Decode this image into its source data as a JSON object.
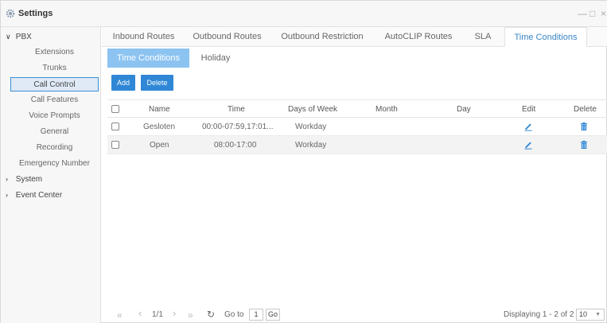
{
  "window": {
    "title": "Settings",
    "controls": {
      "minimize": "—",
      "maximize": "□",
      "close": "×"
    }
  },
  "sidebar": {
    "pbx_label": "PBX",
    "items": [
      {
        "label": "Extensions"
      },
      {
        "label": "Trunks"
      },
      {
        "label": "Call Control",
        "active": true
      },
      {
        "label": "Call Features"
      },
      {
        "label": "Voice Prompts"
      },
      {
        "label": "General"
      },
      {
        "label": "Recording"
      },
      {
        "label": "Emergency Number"
      }
    ],
    "system_label": "System",
    "event_center_label": "Event Center"
  },
  "tabs": [
    {
      "label": "Inbound Routes"
    },
    {
      "label": "Outbound Routes"
    },
    {
      "label": "Outbound Restriction"
    },
    {
      "label": "AutoCLIP Routes"
    },
    {
      "label": "SLA"
    },
    {
      "label": "Time Conditions",
      "active": true
    }
  ],
  "subtabs": [
    {
      "label": "Time Conditions",
      "active": true
    },
    {
      "label": "Holiday"
    }
  ],
  "toolbar": {
    "add_label": "Add",
    "delete_label": "Delete"
  },
  "table": {
    "headers": {
      "name": "Name",
      "time": "Time",
      "days": "Days of Week",
      "month": "Month",
      "day": "Day",
      "edit": "Edit",
      "delete": "Delete"
    },
    "rows": [
      {
        "name": "Gesloten",
        "time": "00:00-07:59,17:01...",
        "days": "Workday",
        "month": "",
        "day": ""
      },
      {
        "name": "Open",
        "time": "08:00-17:00",
        "days": "Workday",
        "month": "",
        "day": ""
      }
    ]
  },
  "pager": {
    "first": "«",
    "prev": "‹",
    "page_info": "1/1",
    "next": "›",
    "last": "»",
    "refresh": "↻",
    "goto_label": "Go to",
    "goto_value": "1",
    "go_label": "Go",
    "displaying": "Displaying 1 - 2 of 2",
    "page_size": "10",
    "page_size_caret": "▼"
  },
  "colors": {
    "accent": "#2f87d6",
    "active_subtab": "#8cc3f1",
    "active_tab_text": "#3a86c8",
    "sidebar_active": "#dfeaf6"
  }
}
